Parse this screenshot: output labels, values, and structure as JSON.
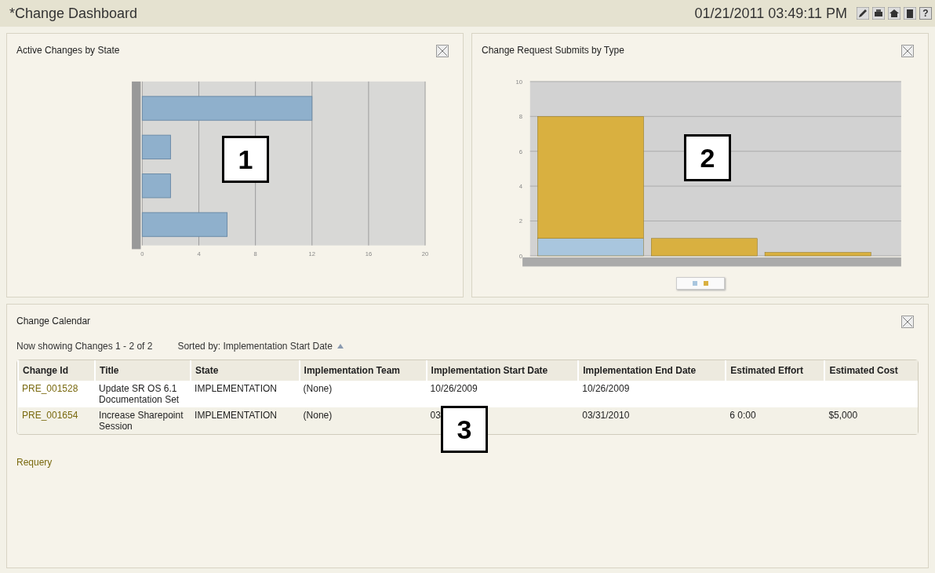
{
  "header": {
    "title": "*Change Dashboard",
    "datetime": "01/21/2011 03:49:11 PM",
    "help_glyph": "?"
  },
  "panels": [
    {
      "title": "Active Changes by State",
      "callout": "1",
      "chart_data": {
        "type": "bar",
        "orientation": "horizontal",
        "grid": true,
        "values": [
          12,
          2,
          2,
          6
        ],
        "xlim": [
          0,
          20
        ],
        "xticks": [
          0,
          4,
          8,
          12,
          16,
          20
        ]
      }
    },
    {
      "title": "Change Request Submits by Type",
      "callout": "2",
      "chart_data": {
        "type": "bar",
        "stacked": true,
        "grid": true,
        "ylim": [
          0,
          10
        ],
        "yticks": [
          0,
          2,
          4,
          6,
          8,
          10
        ],
        "series": [
          {
            "color": "#a9c6de",
            "values": [
              1,
              0,
              0
            ]
          },
          {
            "color": "#d9b040",
            "values": [
              7,
              1,
              0.2
            ]
          }
        ]
      }
    }
  ],
  "calendar": {
    "title": "Change Calendar",
    "showing": "Now showing Changes 1 - 2 of 2",
    "sorted_by": "Sorted by: Implementation Start Date",
    "callout": "3",
    "columns": [
      "Change Id",
      "Title",
      "State",
      "Implementation Team",
      "Implementation Start Date",
      "Implementation End Date",
      "Estimated Effort",
      "Estimated Cost"
    ],
    "rows": [
      {
        "cells": [
          "PRE_001528",
          "Update SR OS 6.1 Documentation Set",
          "IMPLEMENTATION",
          "(None)",
          "10/26/2009",
          "10/26/2009",
          "",
          ""
        ]
      },
      {
        "cells": [
          "PRE_001654",
          "Increase Sharepoint Session",
          "IMPLEMENTATION",
          "(None)",
          "03",
          "03/31/2010",
          "6 0:00",
          "$5,000"
        ]
      }
    ],
    "requery": "Requery"
  }
}
